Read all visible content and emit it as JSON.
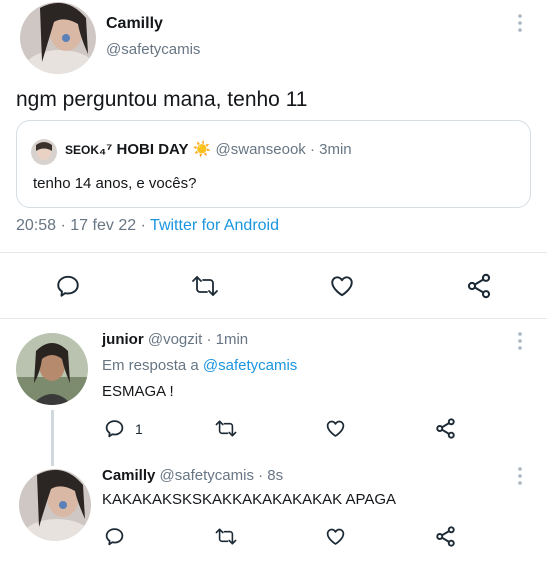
{
  "main_tweet": {
    "display_name": "Camilly",
    "handle": "@safetycamis",
    "text": "ngm perguntou mana, tenho 11",
    "timestamp": "20:58",
    "date": "17 fev 22",
    "source": "Twitter for Android",
    "quoted": {
      "name_prefix": "SEOK",
      "name_suffix": "₄⁷ HOBI DAY",
      "emoji": "☀️",
      "handle": "@swanseook",
      "time": "3min",
      "text": "tenho 14 anos, e vocês?"
    }
  },
  "reply1": {
    "display_name": "junior",
    "handle": "@vogzit",
    "time": "1min",
    "reply_prefix": "Em resposta a",
    "reply_to": "@safetycamis",
    "text": "ESMAGA !",
    "reply_count": "1"
  },
  "reply2": {
    "display_name": "Camilly",
    "handle": "@safetycamis",
    "time": "8s",
    "text": "KAKAKAKSKSKAKKAKAKAKAKAK APAGA"
  },
  "separators": {
    "dot": "·"
  },
  "colors": {
    "link": "#1b95e0",
    "muted": "#687684",
    "icon": "#1c2a36"
  }
}
